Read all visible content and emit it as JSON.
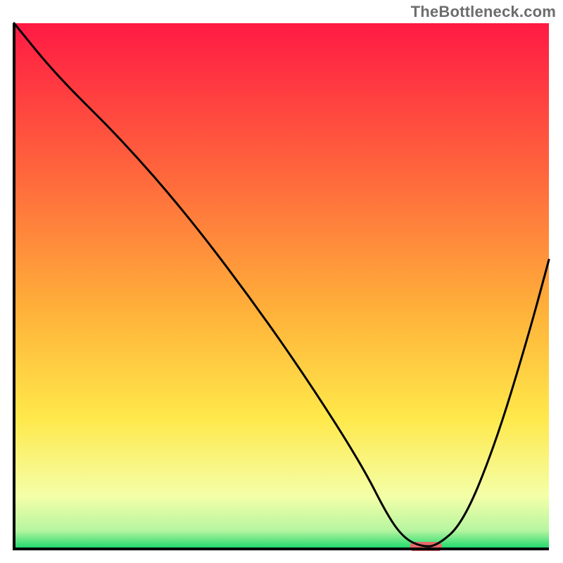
{
  "watermark": "TheBottleneck.com",
  "colors": {
    "gradient_top": "#ff1a44",
    "gradient_mid1": "#ff8a3d",
    "gradient_mid2": "#ffd43a",
    "gradient_mid3": "#fff96a",
    "gradient_bottom": "#17d86a",
    "axis": "#000000",
    "curve": "#000000",
    "marker": "#e56a6a"
  },
  "chart_data": {
    "type": "line",
    "title": "",
    "xlabel": "",
    "ylabel": "",
    "xlim": [
      0,
      100
    ],
    "ylim": [
      0,
      100
    ],
    "series": [
      {
        "name": "bottleneck-curve",
        "x": [
          0,
          8,
          20,
          32,
          44,
          55,
          65,
          70,
          73,
          76,
          79,
          84,
          90,
          96,
          100
        ],
        "y": [
          100,
          90,
          78,
          64,
          48,
          32,
          16,
          6,
          2,
          0.5,
          0.5,
          5,
          20,
          40,
          55
        ]
      }
    ],
    "marker": {
      "name": "optimal-range",
      "x_start": 74,
      "x_end": 80,
      "y": 0.4
    },
    "background_gradient": {
      "stops": [
        {
          "offset": 0.0,
          "color": "#ff1a44"
        },
        {
          "offset": 0.3,
          "color": "#ff6a3c"
        },
        {
          "offset": 0.55,
          "color": "#ffb23a"
        },
        {
          "offset": 0.75,
          "color": "#ffe84a"
        },
        {
          "offset": 0.9,
          "color": "#f4ffa8"
        },
        {
          "offset": 0.965,
          "color": "#b7f5a0"
        },
        {
          "offset": 1.0,
          "color": "#17d86a"
        }
      ]
    }
  }
}
